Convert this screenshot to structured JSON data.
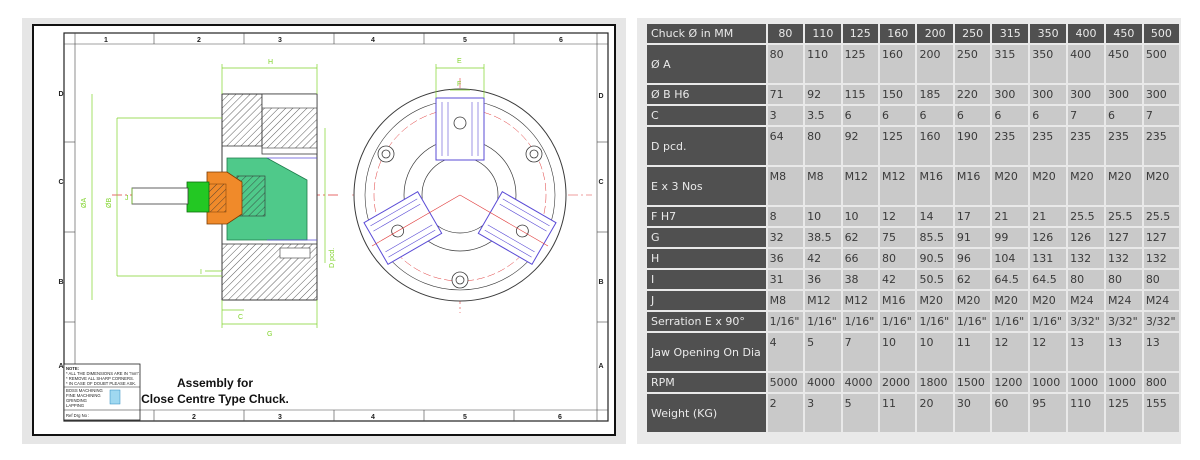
{
  "drawing": {
    "title_line1": "Assembly for",
    "title_line2": "Close Centre Type Chuck.",
    "zone_cols": [
      "1",
      "2",
      "3",
      "4",
      "5",
      "6"
    ],
    "zone_rows": [
      "D",
      "C",
      "B",
      "A"
    ],
    "notes": [
      "NOTE:",
      "* ALL THE DIMENSIONS ARE IN \"mm\".",
      "* REMOVE ALL SHARP CORNERS.",
      "* IN CASE OF DOUBT PLEASE ASK."
    ],
    "company": [
      "BOSS MACHINING",
      "FINE MACHINING",
      "GRINDING",
      "LAPPING"
    ],
    "ref_label": "Ref Drg No :",
    "dim_labels": {
      "H": "H",
      "F": "F",
      "E": "E",
      "C": "C",
      "G": "G",
      "I": "I",
      "J": "J",
      "DA": "ØA",
      "DB": "ØB",
      "Dpcd": "D pcd."
    },
    "colors": {
      "outline": "#3a3a3a",
      "dimension": "#7fd32a",
      "jaw": "#5a4bd6",
      "body_fill": "#4fc98a",
      "sleeve": "#f08a2a",
      "bolt": "#23c823",
      "centerline": "#e03a3a"
    }
  },
  "spec_table": {
    "header_label": "Chuck Ø in MM",
    "sizes": [
      "80",
      "110",
      "125",
      "160",
      "200",
      "250",
      "315",
      "350",
      "400",
      "450",
      "500"
    ],
    "rows": [
      {
        "label": "Ø A",
        "values": [
          "80",
          "110",
          "125",
          "160",
          "200",
          "250",
          "315",
          "350",
          "400",
          "450",
          "500"
        ],
        "tall": true
      },
      {
        "label": " Ø B H6",
        "values": [
          "71",
          "92",
          "115",
          "150",
          "185",
          "220",
          "300",
          "300",
          "300",
          "300",
          "300"
        ]
      },
      {
        "label": "C",
        "values": [
          "3",
          "3.5",
          "6",
          "6",
          "6",
          "6",
          "6",
          "6",
          "7",
          "6",
          "7"
        ]
      },
      {
        "label": "D pcd.",
        "values": [
          "64",
          "80",
          "92",
          "125",
          "160",
          "190",
          "235",
          "235",
          "235",
          "235",
          "235"
        ],
        "tall": true
      },
      {
        "label": "E x 3 Nos",
        "values": [
          "M8",
          "M8",
          "M12",
          "M12",
          "M16",
          "M16",
          "M20",
          "M20",
          "M20",
          "M20",
          "M20"
        ],
        "tall": true
      },
      {
        "label": "F H7",
        "values": [
          "8",
          "10",
          "10",
          "12",
          "14",
          "17",
          "21",
          "21",
          "25.5",
          "25.5",
          "25.5"
        ]
      },
      {
        "label": "G",
        "values": [
          "32",
          "38.5",
          "62",
          "75",
          "85.5",
          "91",
          "99",
          "126",
          "126",
          "127",
          "127"
        ]
      },
      {
        "label": "H",
        "values": [
          "36",
          "42",
          "66",
          "80",
          "90.5",
          "96",
          "104",
          "131",
          "132",
          "132",
          "132"
        ]
      },
      {
        "label": "I",
        "values": [
          "31",
          "36",
          "38",
          "42",
          "50.5",
          "62",
          "64.5",
          "64.5",
          "80",
          "80",
          "80"
        ]
      },
      {
        "label": "J",
        "values": [
          "M8",
          "M12",
          "M12",
          "M16",
          "M20",
          "M20",
          "M20",
          "M20",
          "M24",
          "M24",
          "M24"
        ]
      },
      {
        "label": "Serration E x 90°",
        "values": [
          "1/16\"",
          "1/16\"",
          "1/16\"",
          "1/16\"",
          "1/16\"",
          "1/16\"",
          "1/16\"",
          "1/16\"",
          "3/32\"",
          "3/32\"",
          "3/32\""
        ]
      },
      {
        "label": "Jaw Opening On Dia",
        "values": [
          "4",
          "5",
          "7",
          "10",
          "10",
          "11",
          "12",
          "12",
          "13",
          "13",
          "13"
        ],
        "tall": true
      },
      {
        "label": "RPM",
        "values": [
          "5000",
          "4000",
          "4000",
          "2000",
          "1800",
          "1500",
          "1200",
          "1000",
          "1000",
          "1000",
          "800"
        ]
      },
      {
        "label": "Weight (KG)",
        "values": [
          "2",
          "3",
          "5",
          "11",
          "20",
          "30",
          "60",
          "95",
          "110",
          "125",
          "155"
        ],
        "tall": true
      }
    ]
  }
}
